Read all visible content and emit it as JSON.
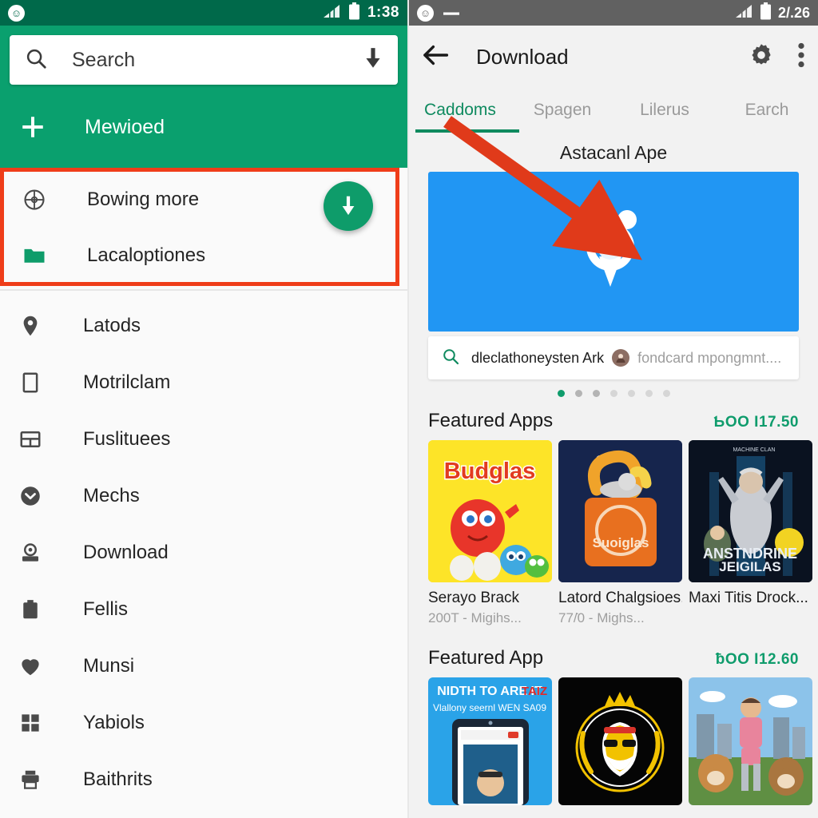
{
  "left_panel": {
    "status_bar": {
      "app_icon": "ghost-icon",
      "signal_icon": "signal-bars-icon",
      "battery_icon": "battery-icon",
      "time": "1:38"
    },
    "search": {
      "placeholder": "Search",
      "search_icon": "search-icon",
      "voice_icon": "download-arrow-icon"
    },
    "new_item": {
      "icon": "plus-icon",
      "label": "Mewioed"
    },
    "highlighted_group": {
      "highlight_color": "#ef3d19",
      "items": [
        {
          "icon": "compass-icon",
          "label": "Bowing more"
        },
        {
          "icon": "folder-icon",
          "label": "Lacaloptiones"
        }
      ],
      "fab": {
        "icon": "download-arrow-icon",
        "color": "#0e9c6a"
      }
    },
    "nav_items": [
      {
        "icon": "location-pin-icon",
        "label": "Latods"
      },
      {
        "icon": "square-outline-icon",
        "label": "Motrilclam"
      },
      {
        "icon": "layout-icon",
        "label": "Fuslituees"
      },
      {
        "icon": "chevron-down-circle-icon",
        "label": "Mechs"
      },
      {
        "icon": "download-box-icon",
        "label": "Download"
      },
      {
        "icon": "briefcase-icon",
        "label": "Fellis"
      },
      {
        "icon": "heart-icon",
        "label": "Munsi"
      },
      {
        "icon": "grid-icon",
        "label": "Yabiols"
      },
      {
        "icon": "printer-icon",
        "label": "Baithrits"
      }
    ]
  },
  "right_panel": {
    "status_bar": {
      "app_icon": "ghost-icon",
      "minus_icon": "minus-icon",
      "signal_icon": "signal-bars-icon",
      "battery_icon": "battery-icon",
      "battery_text": "2/.26"
    },
    "toolbar": {
      "back_icon": "back-arrow-icon",
      "title": "Download",
      "settings_icon": "gear-icon",
      "overflow_icon": "more-vertical-icon"
    },
    "tabs": [
      {
        "label": "Caddoms",
        "active": true
      },
      {
        "label": "Spagen",
        "active": false
      },
      {
        "label": "Lilerus",
        "active": false
      },
      {
        "label": "Earch",
        "active": false
      }
    ],
    "hero_title": "Astacanl Ape",
    "banner": {
      "color": "#2196f3",
      "logo_icon": "location-person-icon"
    },
    "card_search": {
      "icon": "search-icon",
      "text": "dleclathoneysten Ark",
      "avatar_icon": "avatar-icon",
      "subtext": "fondcard mpongmnt...."
    },
    "carousel_dots": {
      "count": 7,
      "active_index": 0,
      "active_color": "#0f9c6c"
    },
    "sections": [
      {
        "title": "Featured Apps",
        "price": "ƄOO I17.50",
        "apps": [
          {
            "name": "Serayo Brack",
            "meta": "200T - Migihs...",
            "art": "budglas",
            "art_title": "Budglas"
          },
          {
            "name": "Latord Chalgsioes.",
            "meta": "77/̇0 - Mighs...",
            "art": "sudiglas",
            "art_title": "Suoiglas"
          },
          {
            "name": "Maxi Titis Drock...",
            "meta": "",
            "art": "anstndrine",
            "art_title": "ANSTNDRINE JEIGILAS"
          }
        ]
      },
      {
        "title": "Featured App",
        "price": "ƀOO I12.60",
        "apps": [
          {
            "name": "",
            "meta": "",
            "art": "tablet-promo",
            "art_title": "NIDTH TO ARE IT TAIZ"
          },
          {
            "name": "",
            "meta": "",
            "art": "crown-crest",
            "art_title": ""
          },
          {
            "name": "",
            "meta": "",
            "art": "hero-bears",
            "art_title": ""
          }
        ]
      }
    ]
  },
  "annotation": {
    "arrow_color": "#e03a1a",
    "description": "red arrow pointing from Caddoms tab to banner logo"
  }
}
